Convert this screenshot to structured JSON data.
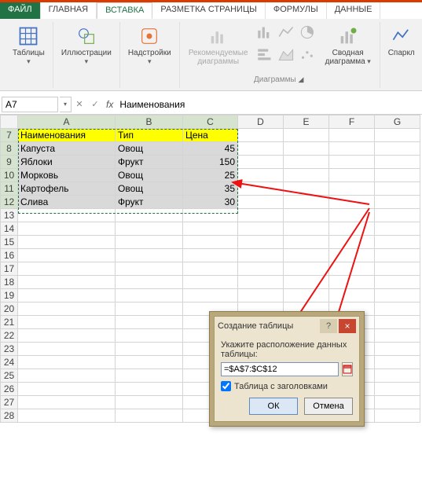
{
  "tabs": {
    "file": "ФАЙЛ",
    "home": "ГЛАВНАЯ",
    "insert": "ВСТАВКА",
    "pageLayout": "РАЗМЕТКА СТРАНИЦЫ",
    "formulas": "ФОРМУЛЫ",
    "data": "ДАННЫЕ"
  },
  "ribbon": {
    "tables": "Таблицы",
    "illustrations": "Иллюстрации",
    "addins": "Надстройки",
    "recCharts": "Рекомендуемые диаграммы",
    "pivotChart": "Сводная диаграмма",
    "chartsGroup": "Диаграммы",
    "sparklines": "Спаркл"
  },
  "namebox": "A7",
  "formula": "Наименования",
  "cols": [
    "A",
    "B",
    "C",
    "D",
    "E",
    "F",
    "G"
  ],
  "rows": [
    7,
    8,
    9,
    10,
    11,
    12,
    13,
    14,
    15,
    16,
    17,
    18,
    19,
    20,
    21,
    22,
    23,
    24,
    25,
    26,
    27,
    28
  ],
  "data": {
    "header": [
      "Наименования",
      "Тип",
      "Цена"
    ],
    "r8": [
      "Капуста",
      "Овощ",
      "45"
    ],
    "r9": [
      "Яблоки",
      "Фрукт",
      "150"
    ],
    "r10": [
      "Морковь",
      "Овощ",
      "25"
    ],
    "r11": [
      "Картофель",
      "Овощ",
      "35"
    ],
    "r12": [
      "Слива",
      "Фрукт",
      "30"
    ]
  },
  "dialog": {
    "title": "Создание таблицы",
    "prompt": "Укажите расположение данных таблицы:",
    "range": "=$A$7:$C$12",
    "checkbox": "Таблица с заголовками",
    "ok": "ОК",
    "cancel": "Отмена",
    "help": "?",
    "close": "×"
  }
}
